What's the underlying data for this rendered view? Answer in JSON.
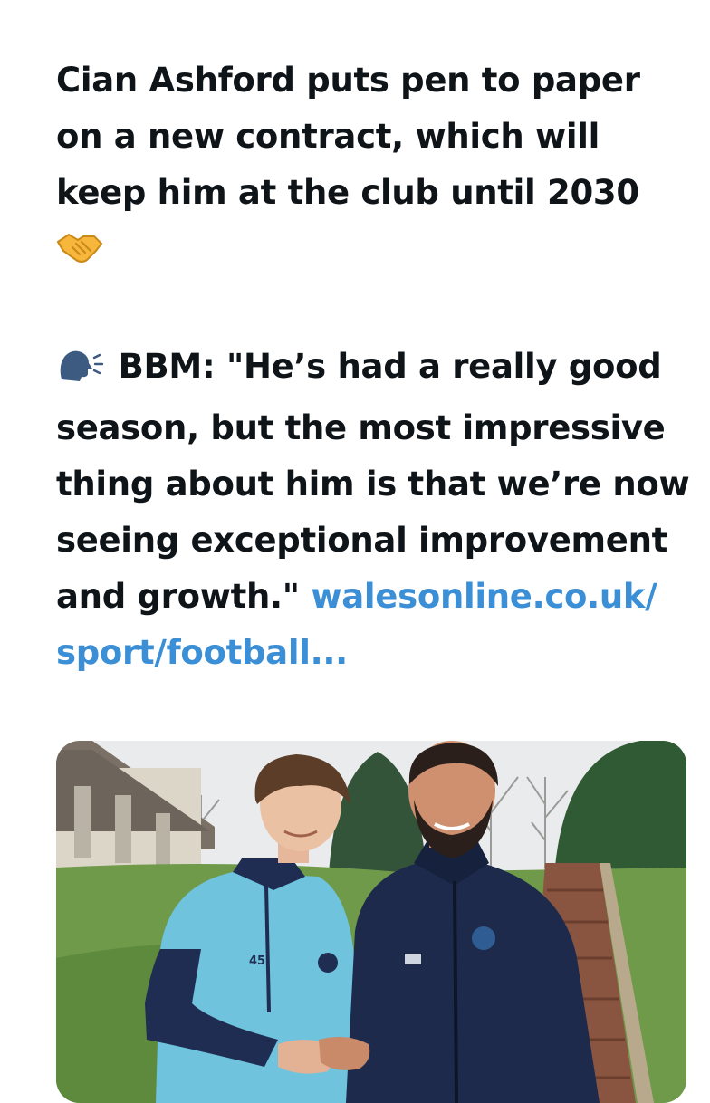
{
  "tweet": {
    "headline": "Cian Ashford puts pen to paper on a new contract, which will keep him at the club until 2030",
    "quote_text": "BBM: \"He’s had a really good season, but the most impressive thing about him is that we’re now seeing exceptional improvement and growth.\"",
    "link_text": "walesonline.co.uk/ sport/football..."
  },
  "media": {
    "shirt_number": "45",
    "sky_color": "#e9ebec",
    "grass_color": "#6f9a4a"
  }
}
